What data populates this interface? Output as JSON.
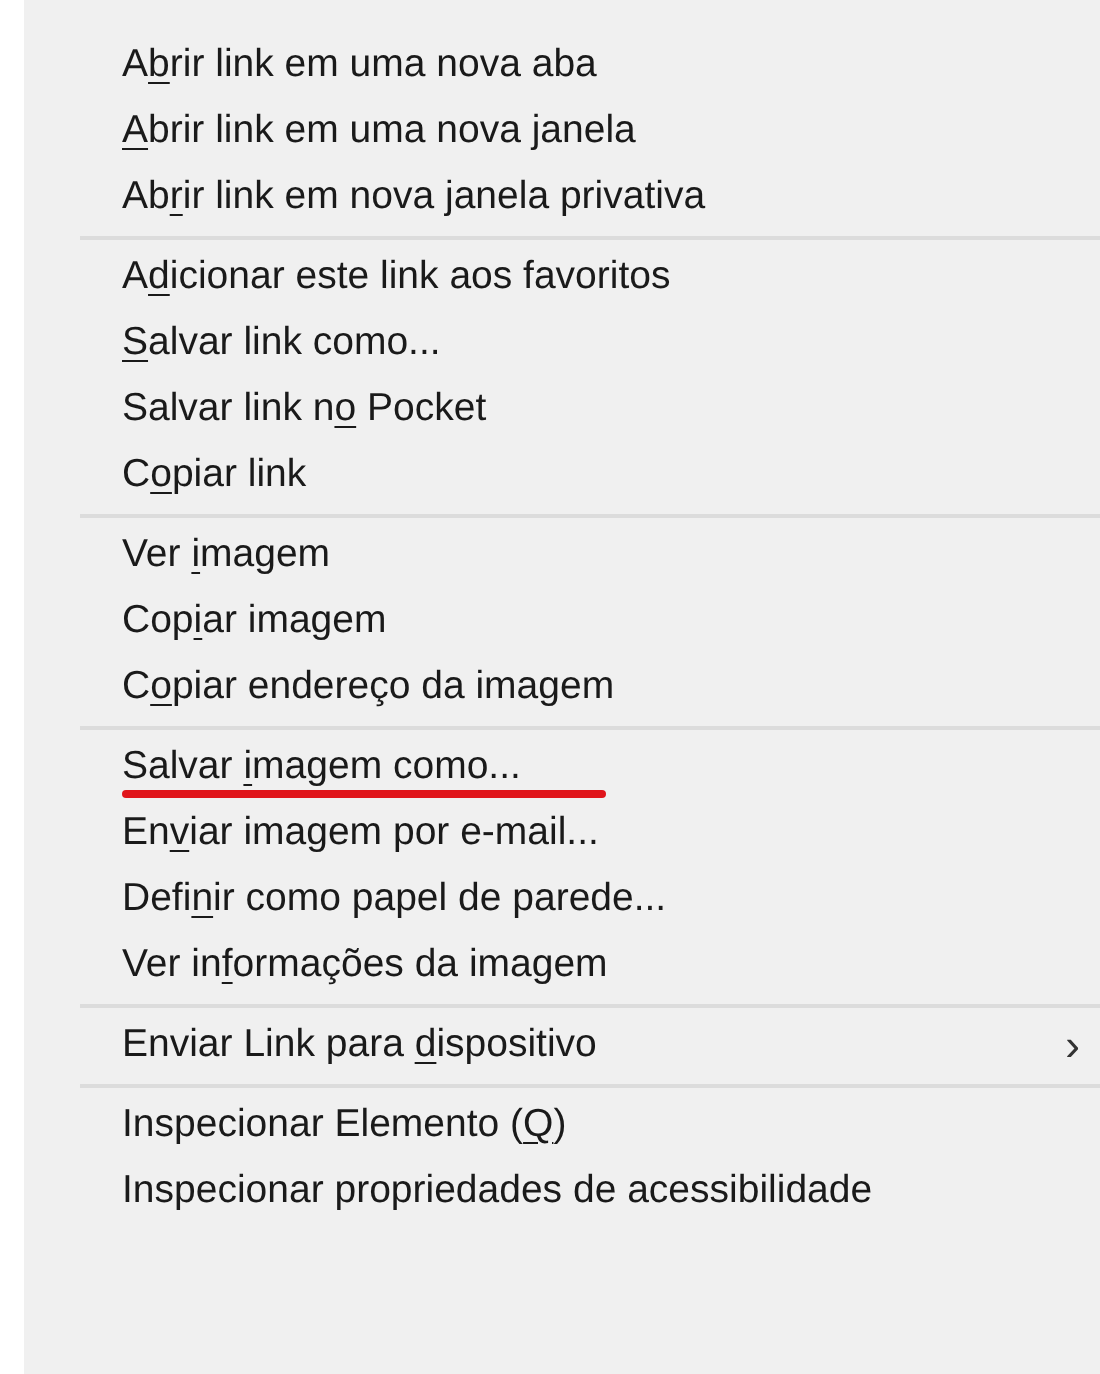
{
  "context_menu": {
    "groups": [
      {
        "items": [
          {
            "pre": "A",
            "key": "b",
            "post": "rir link em uma nova aba",
            "annotated": false
          },
          {
            "key": "A",
            "post": "brir link em uma nova janela",
            "annotated": false
          },
          {
            "pre": "Ab",
            "key": "r",
            "post": "ir link em nova janela privativa",
            "annotated": false
          }
        ]
      },
      {
        "items": [
          {
            "pre": "A",
            "key": "d",
            "post": "icionar este link aos favoritos",
            "annotated": false
          },
          {
            "key": "S",
            "post": "alvar link como...",
            "annotated": false
          },
          {
            "pre": "Salvar link n",
            "key": "o",
            "post": " Pocket",
            "annotated": false
          },
          {
            "pre": "C",
            "key": "o",
            "post": "piar link",
            "annotated": false
          }
        ]
      },
      {
        "items": [
          {
            "pre": "Ver ",
            "key": "i",
            "post": "magem",
            "annotated": false
          },
          {
            "pre": "Cop",
            "key": "i",
            "post": "ar imagem",
            "annotated": false
          },
          {
            "pre": "C",
            "key": "o",
            "post": "piar endereço da imagem",
            "annotated": false
          }
        ]
      },
      {
        "items": [
          {
            "pre": "Salvar ",
            "key": "i",
            "post": "magem como...",
            "annotated": true
          },
          {
            "pre": "En",
            "key": "v",
            "post": "iar imagem por e-mail...",
            "annotated": false
          },
          {
            "pre": "Defi",
            "key": "n",
            "post": "ir como papel de parede...",
            "annotated": false
          },
          {
            "pre": "Ver in",
            "key": "f",
            "post": "ormações da imagem",
            "annotated": false
          }
        ]
      },
      {
        "items": [
          {
            "pre": "Enviar Link para ",
            "key": "d",
            "post": "ispositivo",
            "annotated": false,
            "submenu_arrow": "›"
          }
        ]
      },
      {
        "items": [
          {
            "pre": "Inspecionar Elemento (",
            "key": "Q",
            "post": ")",
            "annotated": false
          },
          {
            "pre": "Inspecionar propriedades de acessibilidade",
            "annotated": false
          }
        ]
      }
    ]
  }
}
